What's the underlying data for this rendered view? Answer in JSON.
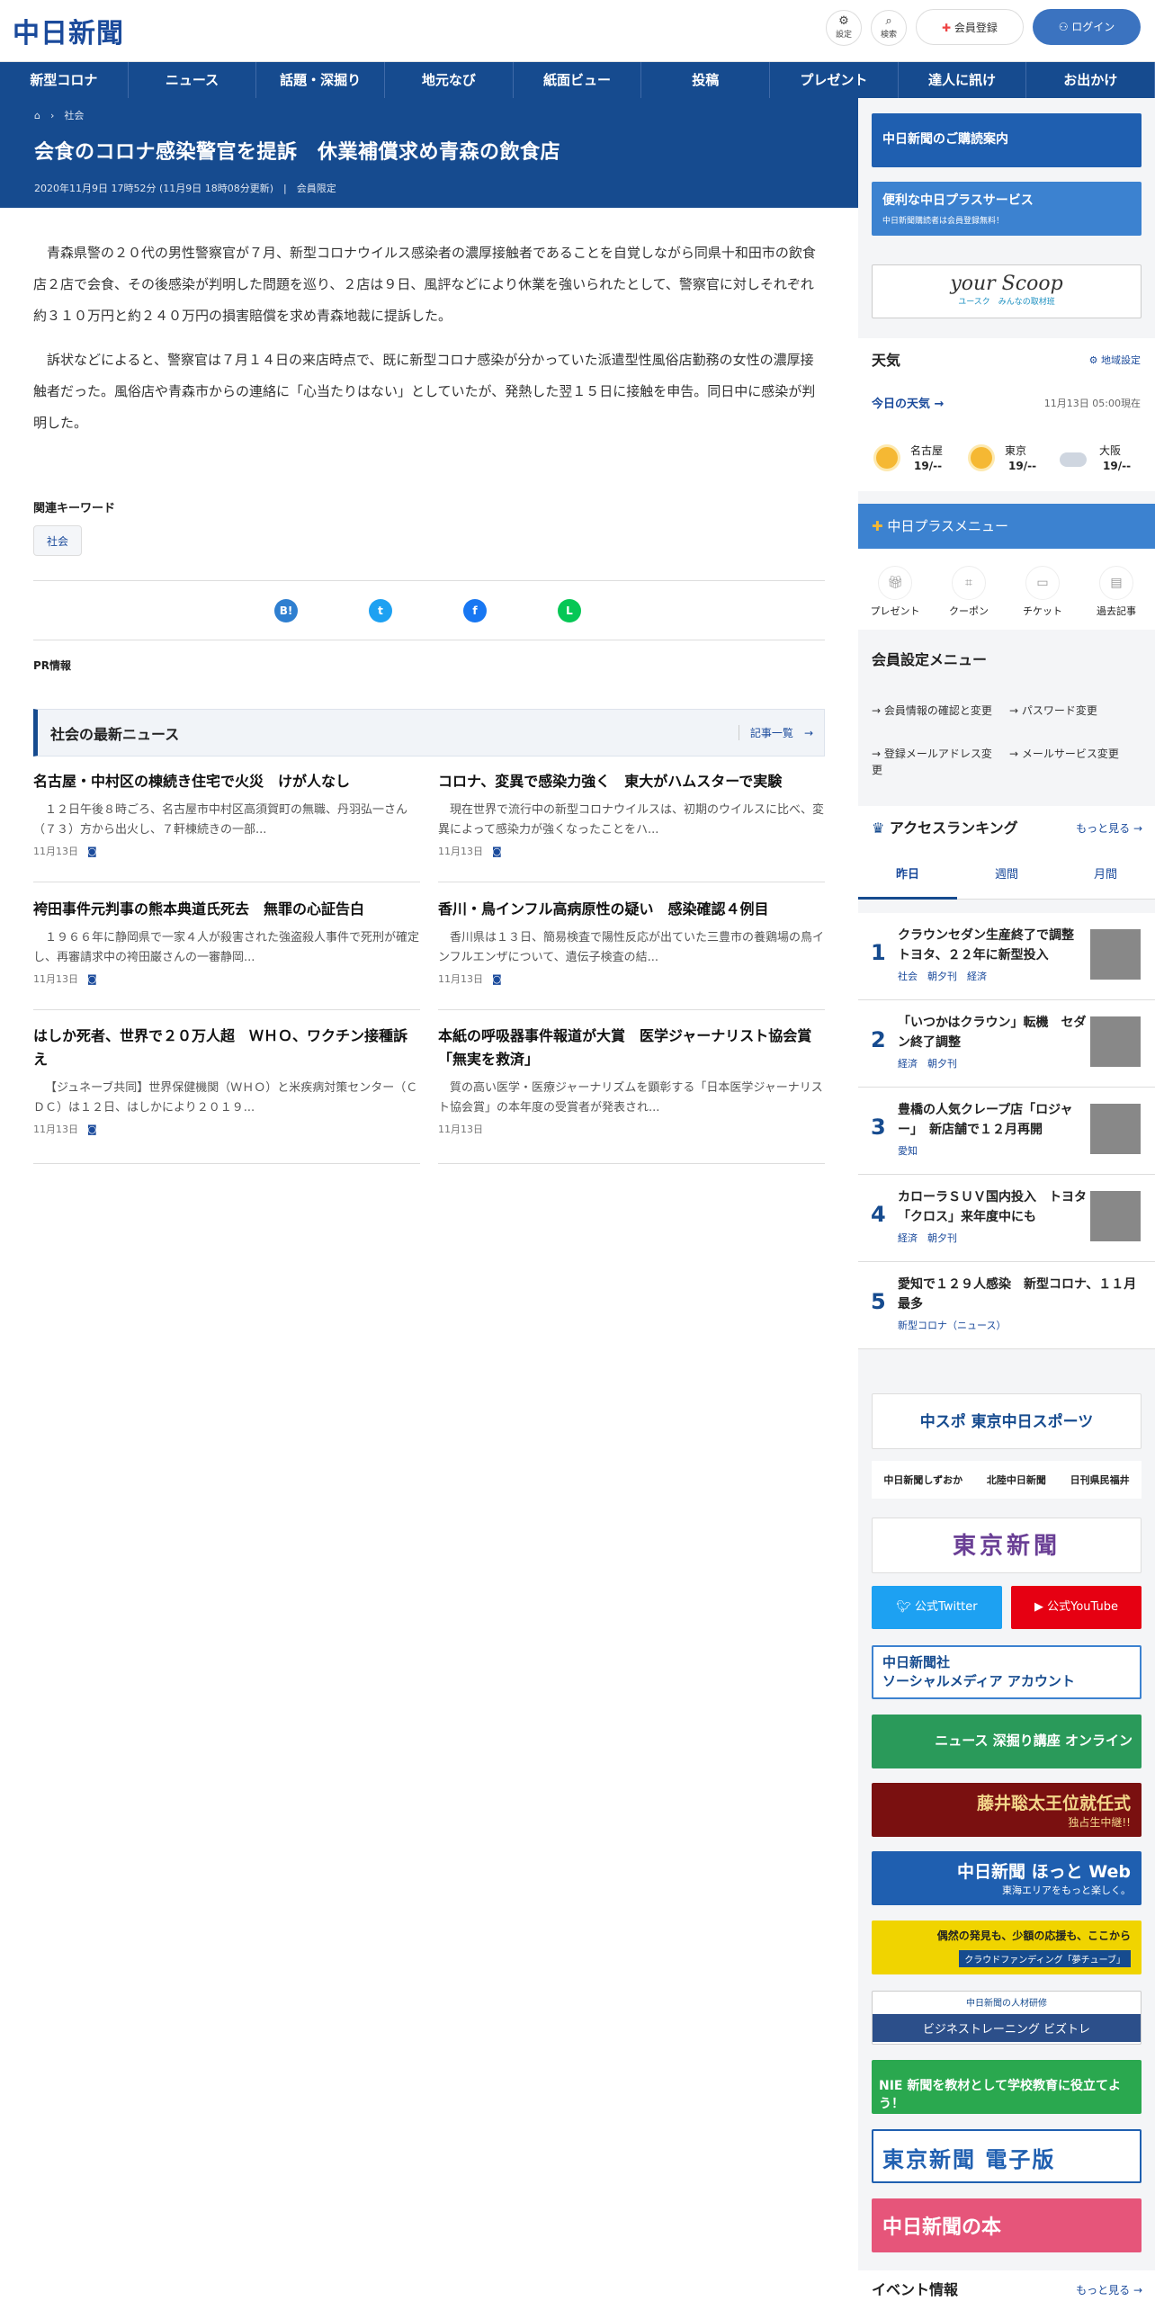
{
  "header": {
    "logo": "中日新聞",
    "settings_label": "設定",
    "search_label": "検索",
    "register_label": "会員登録",
    "login_label": "ログイン"
  },
  "nav": [
    "新型コロナ",
    "ニュース",
    "話題・深掘り",
    "地元なび",
    "紙面ビュー",
    "投稿",
    "プレゼント",
    "達人に訊け",
    "お出かけ"
  ],
  "article": {
    "breadcrumb_section": "社会",
    "title": "会食のコロナ感染警官を提訴　休業補償求め青森の飲食店",
    "published": "2020年11月9日 17時52分 (11月9日 18時08分更新)",
    "member_tag": "会員限定",
    "paragraphs": [
      "青森県警の２０代の男性警察官が７月、新型コロナウイルス感染者の濃厚接触者であることを自覚しながら同県十和田市の飲食店２店で会食、その後感染が判明した問題を巡り、２店は９日、風評などにより休業を強いられたとして、警察官に対しそれぞれ約３１０万円と約２４０万円の損害賠償を求め青森地裁に提訴した。",
      "訴状などによると、警察官は７月１４日の来店時点で、既に新型コロナ感染が分かっていた派遣型性風俗店勤務の女性の濃厚接触者だった。風俗店や青森市からの連絡に「心当たりはない」としていたが、発熱した翌１５日に接触を申告。同日中に感染が判明した。"
    ],
    "keywords_heading": "関連キーワード",
    "keyword": "社会",
    "pr_label": "PR情報"
  },
  "latest": {
    "heading": "社会の最新ニュース",
    "more_label": "記事一覧",
    "items": [
      {
        "title": "名古屋・中村区の棟続き住宅で火災　けが人なし",
        "summary": "１２日午後８時ごろ、名古屋市中村区高須賀町の無職、丹羽弘一さん（７３）方から出火し、７軒棟続きの一部...",
        "date": "11月13日",
        "photo": true
      },
      {
        "title": "コロナ、変異で感染力強く　東大がハムスターで実験",
        "summary": "現在世界で流行中の新型コロナウイルスは、初期のウイルスに比べ、変異によって感染力が強くなったことをハ...",
        "date": "11月13日",
        "photo": true
      },
      {
        "title": "袴田事件元判事の熊本典道氏死去　無罪の心証告白",
        "summary": "１９６６年に静岡県で一家４人が殺害された強盗殺人事件で死刑が確定し、再審請求中の袴田巌さんの一審静岡...",
        "date": "11月13日",
        "photo": true
      },
      {
        "title": "香川・鳥インフル高病原性の疑い　感染確認４例目",
        "summary": "香川県は１３日、簡易検査で陽性反応が出ていた三豊市の養鶏場の鳥インフルエンザについて、遺伝子検査の結...",
        "date": "11月13日",
        "photo": true
      },
      {
        "title": "はしか死者、世界で２０万人超　ＷＨＯ、ワクチン接種訴え",
        "summary": "【ジュネーブ共同】世界保健機関（ＷＨＯ）と米疾病対策センター（ＣＤＣ）は１２日、はしかにより２０１９...",
        "date": "11月13日",
        "photo": true
      },
      {
        "title": "本紙の呼吸器事件報道が大賞　医学ジャーナリスト協会賞「無実を救済」",
        "summary": "質の高い医学・医療ジャーナリズムを顕彰する「日本医学ジャーナリスト協会賞」の本年度の受賞者が発表され...",
        "date": "11月13日",
        "photo": false
      }
    ]
  },
  "sidebar": {
    "banner_subscribe": "中日新聞のご購読案内",
    "banner_plus": "便利な中日プラスサービス",
    "banner_plus_sub": "中日新聞購読者は会員登録無料！",
    "banner_scoop": "your Scoop",
    "banner_scoop_sub": "ユースク　みんなの取材班",
    "weather_heading": "天気",
    "weather_setting": "地域設定",
    "weather_today": "今日の天気",
    "weather_time": "11月13日 05:00現在",
    "weather": [
      {
        "city": "名古屋",
        "temp": "19/--",
        "icon": "sun"
      },
      {
        "city": "東京",
        "temp": "19/--",
        "icon": "sun"
      },
      {
        "city": "大阪",
        "temp": "19/--",
        "icon": "cloud"
      }
    ],
    "plus_menu_heading": "中日プラスメニュー",
    "plus_menu": [
      {
        "label": "プレゼント",
        "icon": "gift-icon"
      },
      {
        "label": "クーポン",
        "icon": "coupon-icon"
      },
      {
        "label": "チケット",
        "icon": "ticket-icon"
      },
      {
        "label": "過去記事",
        "icon": "archive-icon"
      }
    ],
    "member_menu_heading": "会員設定メニュー",
    "member_links": [
      "会員情報の確認と変更",
      "パスワード変更",
      "登録メールアドレス変更",
      "メールサービス変更"
    ],
    "ranking_heading": "アクセスランキング",
    "ranking_more": "もっと見る",
    "ranking_tabs": [
      "昨日",
      "週間",
      "月間"
    ],
    "ranking": [
      {
        "rank": "1",
        "title": "クラウンセダン生産終了で調整　トヨタ、２２年に新型投入",
        "cats": "社会　朝夕刊　経済",
        "img": true
      },
      {
        "rank": "2",
        "title": "「いつかはクラウン」転機　セダン終了調整",
        "cats": "経済　朝夕刊",
        "img": true
      },
      {
        "rank": "3",
        "title": "豊橋の人気クレープ店「ロジャー」　新店舗で１２月再開",
        "cats": "愛知",
        "img": true
      },
      {
        "rank": "4",
        "title": "カローラＳＵＶ国内投入　トヨタ「クロス」来年度中にも",
        "cats": "経済　朝夕刊",
        "img": true
      },
      {
        "rank": "5",
        "title": "愛知で１２９人感染　新型コロナ、１１月最多",
        "cats": "新型コロナ（ニュース）",
        "img": false
      }
    ],
    "chuspo": "中スポ 東京中日スポーツ",
    "sister_papers": [
      "中日新聞しずおか",
      "北陸中日新聞",
      "日刊県民福井"
    ],
    "tokyo": "東京新聞",
    "twitter": "公式Twitter",
    "youtube": "公式YouTube",
    "social_banner_1": "中日新聞社",
    "social_banner_2": "ソーシャルメディア アカウント",
    "fukabori": "ニュース 深掘り講座 オンライン",
    "fujii": "藤井聡太王位就任式",
    "fujii_sub": "独占生中継!!",
    "hotto": "中日新聞 ほっと Web",
    "hotto_sub": "東海エリアをもっと楽しく。",
    "crowd": "偶然の発見も、少額の応援も、ここから",
    "crowd_sub": "クラウドファンディング「夢チューブ」",
    "bizu_top": "中日新聞の人材研修",
    "bizu": "ビジネストレーニング ビズトレ",
    "nie": "NIE 新聞を教材として学校教育に役立てよう！",
    "tokyo_e": "東京新聞 電子版",
    "book": "中日新聞の本",
    "event_heading": "イベント情報",
    "event_more": "もっと見る"
  },
  "colors": {
    "brand_blue": "#164b8f",
    "twitter": "#1da1f2",
    "youtube": "#e60012"
  }
}
